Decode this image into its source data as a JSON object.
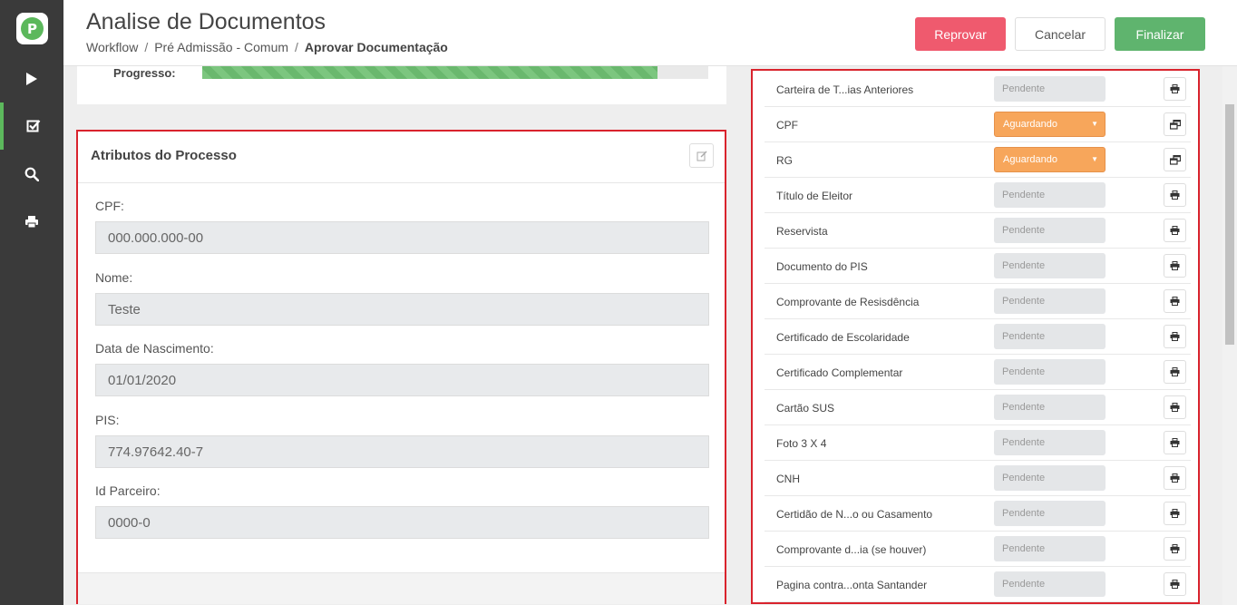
{
  "app": {
    "logo_letter": "P"
  },
  "colors": {
    "accent": "#5cb85c",
    "danger": "#ef5a6e",
    "success": "#5fb46e",
    "warning": "#f7a65b",
    "highlight_border": "#d9232d"
  },
  "sidebar": {
    "items": [
      {
        "icon": "play-icon"
      },
      {
        "icon": "checkbox-icon",
        "active": true
      },
      {
        "icon": "search-icon"
      },
      {
        "icon": "print-icon"
      }
    ]
  },
  "header": {
    "title": "Analise de Documentos",
    "breadcrumb": [
      "Workflow",
      "Pré Admissão - Comum",
      "Aprovar Documentação"
    ],
    "buttons": {
      "reject": "Reprovar",
      "cancel": "Cancelar",
      "finish": "Finalizar"
    }
  },
  "progress": {
    "label": "Progresso:",
    "percent": 90
  },
  "attributes": {
    "title": "Atributos do Processo",
    "fields": [
      {
        "label": "CPF:",
        "value": "000.000.000-00"
      },
      {
        "label": "Nome:",
        "value": "Teste"
      },
      {
        "label": "Data de Nascimento:",
        "value": "01/01/2020"
      },
      {
        "label": "PIS:",
        "value": "774.97642.40-7"
      },
      {
        "label": "Id Parceiro:",
        "value": "0000-0"
      }
    ]
  },
  "documents": [
    {
      "name": "Carteira de T...ias Anteriores",
      "status": "Pendente",
      "state": "pending",
      "action_icon": "print-icon"
    },
    {
      "name": "CPF",
      "status": "Aguardando",
      "state": "waiting",
      "action_icon": "windows-icon"
    },
    {
      "name": "RG",
      "status": "Aguardando",
      "state": "waiting",
      "action_icon": "windows-icon"
    },
    {
      "name": "Título de Eleitor",
      "status": "Pendente",
      "state": "pending",
      "action_icon": "print-icon"
    },
    {
      "name": "Reservista",
      "status": "Pendente",
      "state": "pending",
      "action_icon": "print-icon"
    },
    {
      "name": "Documento do PIS",
      "status": "Pendente",
      "state": "pending",
      "action_icon": "print-icon"
    },
    {
      "name": "Comprovante de Resisdência",
      "status": "Pendente",
      "state": "pending",
      "action_icon": "print-icon"
    },
    {
      "name": "Certificado de Escolaridade",
      "status": "Pendente",
      "state": "pending",
      "action_icon": "print-icon"
    },
    {
      "name": "Certificado Complementar",
      "status": "Pendente",
      "state": "pending",
      "action_icon": "print-icon"
    },
    {
      "name": "Cartão SUS",
      "status": "Pendente",
      "state": "pending",
      "action_icon": "print-icon"
    },
    {
      "name": "Foto 3 X 4",
      "status": "Pendente",
      "state": "pending",
      "action_icon": "print-icon"
    },
    {
      "name": "CNH",
      "status": "Pendente",
      "state": "pending",
      "action_icon": "print-icon"
    },
    {
      "name": "Certidão de N...o ou Casamento",
      "status": "Pendente",
      "state": "pending",
      "action_icon": "print-icon"
    },
    {
      "name": "Comprovante d...ia (se houver)",
      "status": "Pendente",
      "state": "pending",
      "action_icon": "print-icon"
    },
    {
      "name": "Pagina contra...onta Santander",
      "status": "Pendente",
      "state": "pending",
      "action_icon": "print-icon"
    }
  ]
}
